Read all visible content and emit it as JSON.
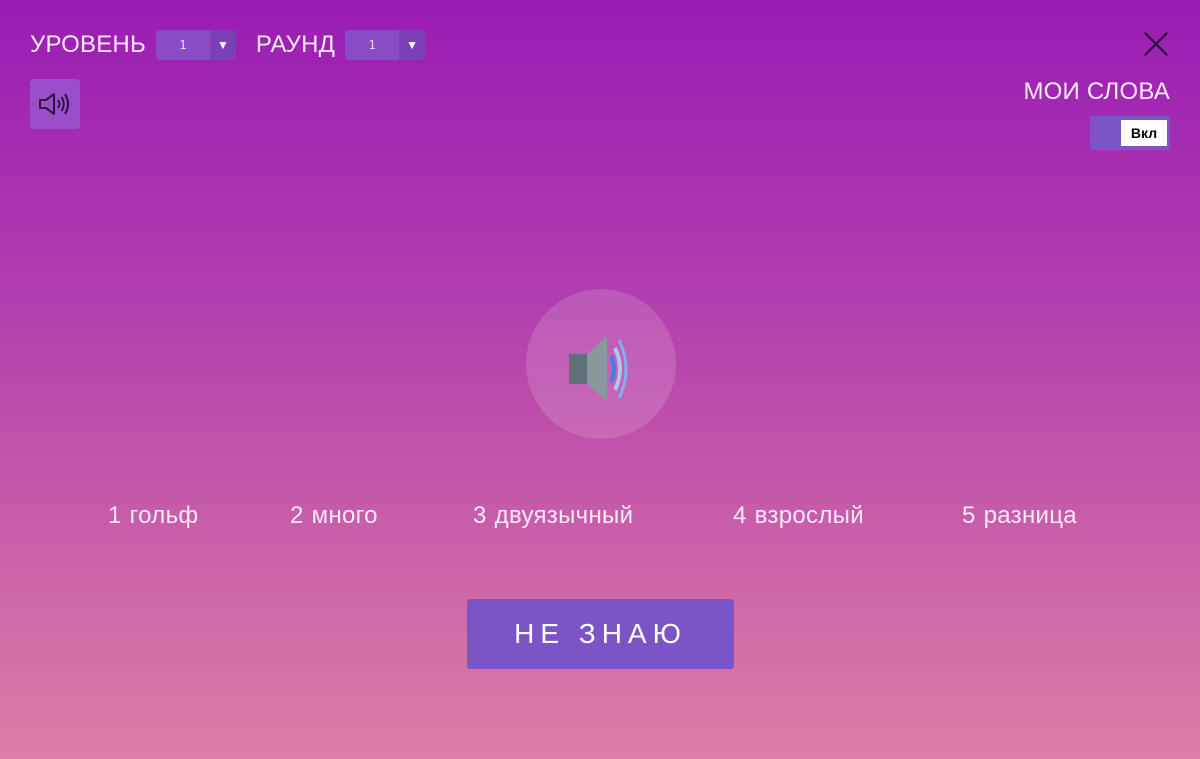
{
  "header": {
    "level_label": "УРОВЕНЬ",
    "level_value": "1",
    "round_label": "РАУНД",
    "round_value": "1"
  },
  "my_words": {
    "title": "МОИ СЛОВА",
    "toggle_label": "Вкл"
  },
  "options": [
    {
      "num": "1",
      "word": "гольф"
    },
    {
      "num": "2",
      "word": "много"
    },
    {
      "num": "3",
      "word": "двуязычный"
    },
    {
      "num": "4",
      "word": "взрослый"
    },
    {
      "num": "5",
      "word": "разница"
    }
  ],
  "dont_know_label": "НЕ ЗНАЮ",
  "colors": {
    "gradient_top": "#9a1cb4",
    "gradient_bottom": "#dc7ea6",
    "button_accent": "#7b55c6"
  },
  "icons": {
    "close": "close-icon",
    "small_speaker": "speaker-icon",
    "big_speaker": "speaker-icon"
  }
}
